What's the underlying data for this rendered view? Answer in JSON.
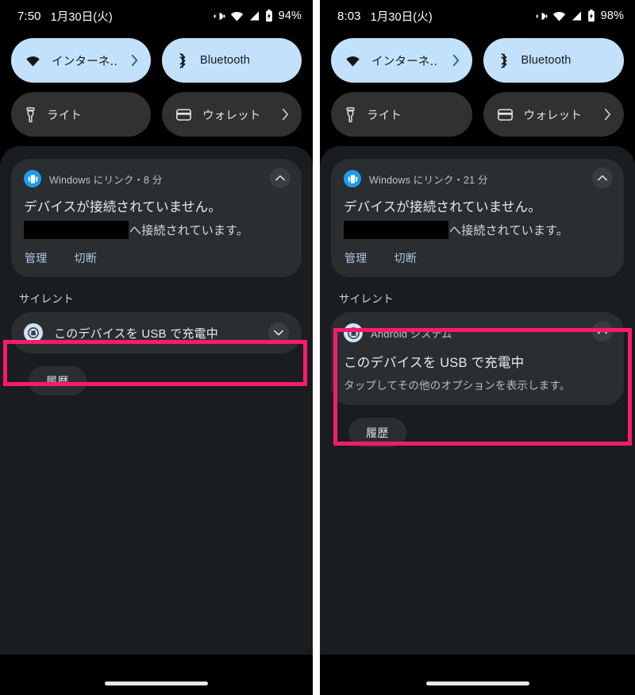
{
  "meta": {
    "accent_pink": "#fa1a6e",
    "tile_on_bg": "#c2e2fb",
    "tile_off_bg": "#2f3133",
    "shade_bg": "#1a1d20",
    "card_bg": "#2b2e31",
    "statusbar_bg": "#000000"
  },
  "panels": [
    {
      "id": "left",
      "statusbar": {
        "time": "7:50",
        "date": "1月30日(火)",
        "battery_percent": "94%",
        "icons": [
          "vibrate-icon",
          "wifi-icon",
          "signal-icon",
          "battery-icon"
        ]
      },
      "quick_settings": {
        "tiles": [
          {
            "label": "インターネ‥",
            "icon": "wifi-icon",
            "state": "on",
            "chevron": true
          },
          {
            "label": "Bluetooth",
            "icon": "bluetooth-icon",
            "state": "on",
            "chevron": false
          },
          {
            "label": "ライト",
            "icon": "flashlight-icon",
            "state": "off",
            "chevron": false
          },
          {
            "label": "ウォレット",
            "icon": "wallet-icon",
            "state": "off",
            "chevron": true
          }
        ]
      },
      "notification": {
        "app_name": "Windows にリンク・8 分",
        "app_icon": "link-to-windows-icon",
        "collapse_icon": "chevron-up-icon",
        "title": "デバイスが接続されていません。",
        "body_suffix": "へ接続されています。",
        "actions": [
          "管理",
          "切断"
        ]
      },
      "silent": {
        "label": "サイレント",
        "usb_notification": {
          "text": "このデバイスを USB で充電中",
          "app_icon": "android-system-icon",
          "expand_icon": "chevron-down-icon",
          "highlighted": true
        }
      },
      "history_button": "履歴"
    },
    {
      "id": "right",
      "statusbar": {
        "time": "8:03",
        "date": "1月30日(火)",
        "battery_percent": "98%",
        "icons": [
          "vibrate-icon",
          "wifi-icon",
          "signal-icon",
          "battery-icon"
        ]
      },
      "quick_settings": {
        "tiles": [
          {
            "label": "インターネ‥",
            "icon": "wifi-icon",
            "state": "on",
            "chevron": true
          },
          {
            "label": "Bluetooth",
            "icon": "bluetooth-icon",
            "state": "on",
            "chevron": false
          },
          {
            "label": "ライト",
            "icon": "flashlight-icon",
            "state": "off",
            "chevron": false
          },
          {
            "label": "ウォレット",
            "icon": "wallet-icon",
            "state": "off",
            "chevron": true
          }
        ]
      },
      "notification": {
        "app_name": "Windows にリンク・21 分",
        "app_icon": "link-to-windows-icon",
        "collapse_icon": "chevron-up-icon",
        "title": "デバイスが接続されていません。",
        "body_suffix": "へ接続されています。",
        "actions": [
          "管理",
          "切断"
        ]
      },
      "silent": {
        "label": "サイレント",
        "usb_notification": {
          "app_name": "Android システム",
          "app_icon": "android-system-icon",
          "collapse_icon": "chevron-up-icon",
          "title": "このデバイスを USB で充電中",
          "subtitle": "タップしてその他のオプションを表示します。",
          "highlighted": true
        }
      },
      "history_button": "履歴"
    }
  ]
}
